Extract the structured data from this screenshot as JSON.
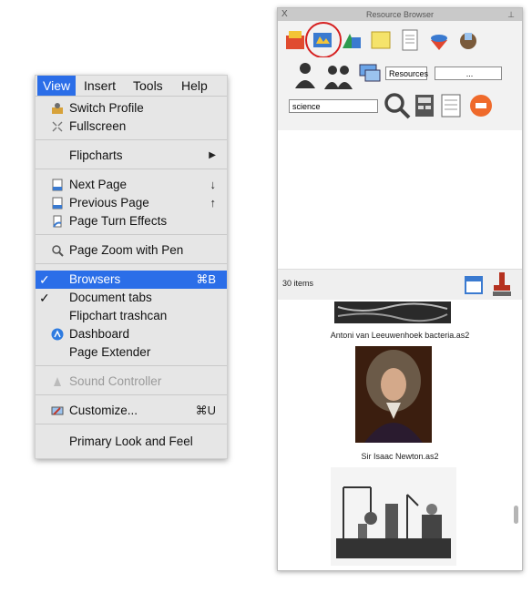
{
  "menu": {
    "bar": [
      "View",
      "Insert",
      "Tools",
      "Help"
    ],
    "items": {
      "switch_profile": "Switch Profile",
      "fullscreen": "Fullscreen",
      "flipcharts": "Flipcharts",
      "next_page": "Next Page",
      "next_page_sc": "↓",
      "previous_page": "Previous Page",
      "previous_page_sc": "↑",
      "page_turn": "Page Turn Effects",
      "page_zoom": "Page Zoom with Pen",
      "browsers": "Browsers",
      "browsers_sc": "⌘B",
      "document_tabs": "Document tabs",
      "flipchart_trashcan": "Flipchart trashcan",
      "dashboard": "Dashboard",
      "page_extender": "Page Extender",
      "sound_controller": "Sound Controller",
      "customize": "Customize...",
      "customize_sc": "⌘U",
      "primary_look": "Primary Look and Feel"
    }
  },
  "browser": {
    "title": "Resource Browser",
    "close": "X",
    "resources_label": "Resources",
    "resources_value": "...",
    "search_value": "science",
    "item_count": "30 items",
    "items": [
      {
        "caption": "Antoni van Leeuwenhoek bacteria.as2"
      },
      {
        "caption": "Sir Isaac Newton.as2"
      }
    ]
  },
  "colors": {
    "menu_highlight": "#2b6ee8",
    "circle_highlight": "#d62020"
  }
}
